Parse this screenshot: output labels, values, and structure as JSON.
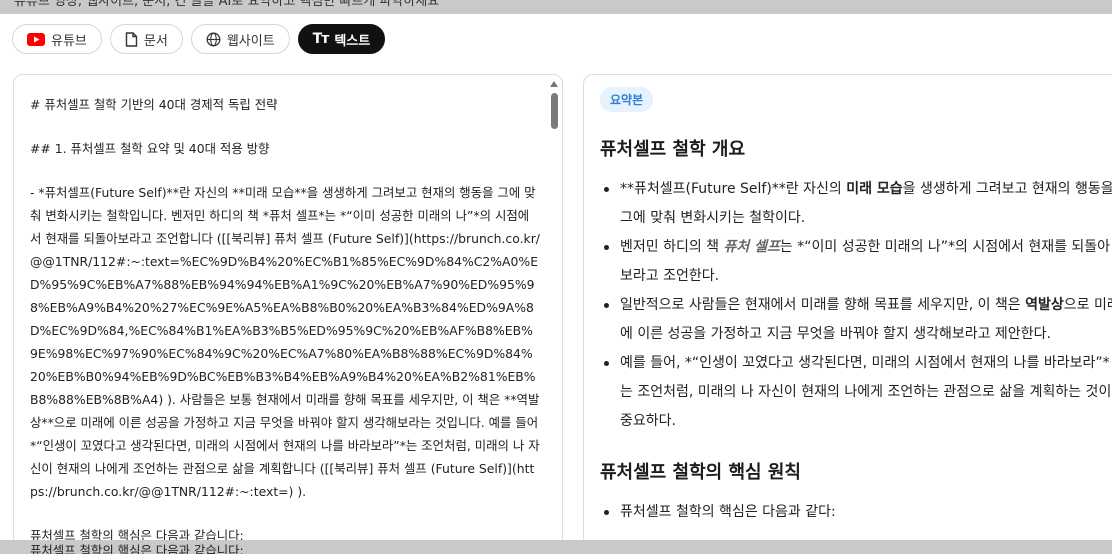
{
  "top_hint": "유튜브 영상, 웹사이트, 문서, 긴 글을 AI로 요약하고 핵심만 빠르게 파악하세요",
  "tabs": [
    {
      "label": "유튜브",
      "icon": "youtube-icon"
    },
    {
      "label": "문서",
      "icon": "document-icon"
    },
    {
      "label": "웹사이트",
      "icon": "globe-icon"
    },
    {
      "label": "텍스트",
      "icon": "text-icon",
      "active": true
    }
  ],
  "colors": {
    "accent": "#2f7fd8",
    "badge_bg": "#e7f2ff",
    "active_tab": "#111111",
    "youtube": "#ff0000"
  },
  "source_text": {
    "h1": "# 퓨처셀프 철학 기반의 40대 경제적 독립 전략",
    "h2": "## 1. 퓨처셀프 철학 요약 및 40대 적용 방향",
    "paragraph": "- *퓨처셀프(Future Self)**란 자신의 **미래 모습**을 생생하게 그려보고 현재의 행동을 그에 맞춰 변화시키는 철학입니다. 벤저민 하디의 책 *퓨처 셀프*는 *“이미 성공한 미래의 나”*의 시점에서 현재를 되돌아보라고 조언합니다 ([[북리뷰] 퓨처 셀프 (Future Self)](https://brunch.co.kr/@@1TNR/112#:~:text=%EC%9D%B4%20%EC%B1%85%EC%9D%84%C2%A0%ED%95%9C%EB%A7%88%EB%94%94%EB%A1%9C%20%EB%A7%90%ED%95%98%EB%A9%B4%20%27%EC%9E%A5%EA%B8%B0%20%EA%B3%84%ED%9A%8D%EC%9D%84,%EC%84%B1%EA%B3%B5%ED%95%9C%20%EB%AF%B8%EB%9E%98%EC%97%90%EC%84%9C%20%EC%A7%80%EA%B8%88%EC%9D%84%20%EB%B0%94%EB%9D%BC%EB%B3%B4%EB%A9%B4%20%EA%B2%81%EB%B8%88%EB%8B%A4) ). 사람들은 보통 현재에서 미래를 향해 목표를 세우지만, 이 책은 **역발상**으로 미래에 이른 성공을 가정하고 지금 무엇을 바꿔야 할지 생각해보라는 것입니다. 예를 들어 *“인생이 꼬였다고 생각된다면, 미래의 시점에서 현재의 나를 바라보라”*는 조언처럼, 미래의 나 자신이 현재의 나에게 조언하는 관점으로 삶을 계획합니다 ([[북리뷰] 퓨처 셀프 (Future Self)](https://brunch.co.kr/@@1TNR/112#:~:text=) ).",
    "next_line": "퓨처셀프 철학의 핵심은 다음과 같습니다:"
  },
  "summary": {
    "badge": "요약본",
    "section1_title": "퓨처셀프 철학 개요",
    "bullets": {
      "b1_pre": "**퓨처셀프(Future Self)**란 자신의 ",
      "b1_bold": "미래 모습",
      "b1_post": "을 생생하게 그려보고 현재의 행동을 그에 맞춰 변화시키는 철학이다.",
      "b2_pre": "벤저민 하디의 책 ",
      "b2_em": "퓨처 셀프",
      "b2_post": "는 *“이미 성공한 미래의 나”*의 시점에서 현재를 되돌아보라고 조언한다.",
      "b3_pre": "일반적으로 사람들은 현재에서 미래를 향해 목표를 세우지만, 이 책은 ",
      "b3_bold": "역발상",
      "b3_post": "으로 미래에 이른 성공을 가정하고 지금 무엇을 바꿔야 할지 생각해보라고 제안한다.",
      "b4": "예를 들어, *“인생이 꼬였다고 생각된다면, 미래의 시점에서 현재의 나를 바라보라”*는 조언처럼, 미래의 나 자신이 현재의 나에게 조언하는 관점으로 삶을 계획하는 것이 중요하다."
    },
    "section2_title": "퓨처셀프 철학의 핵심 원칙",
    "section2_bullet": "퓨처셀프 철학의 핵심은 다음과 같다:"
  }
}
